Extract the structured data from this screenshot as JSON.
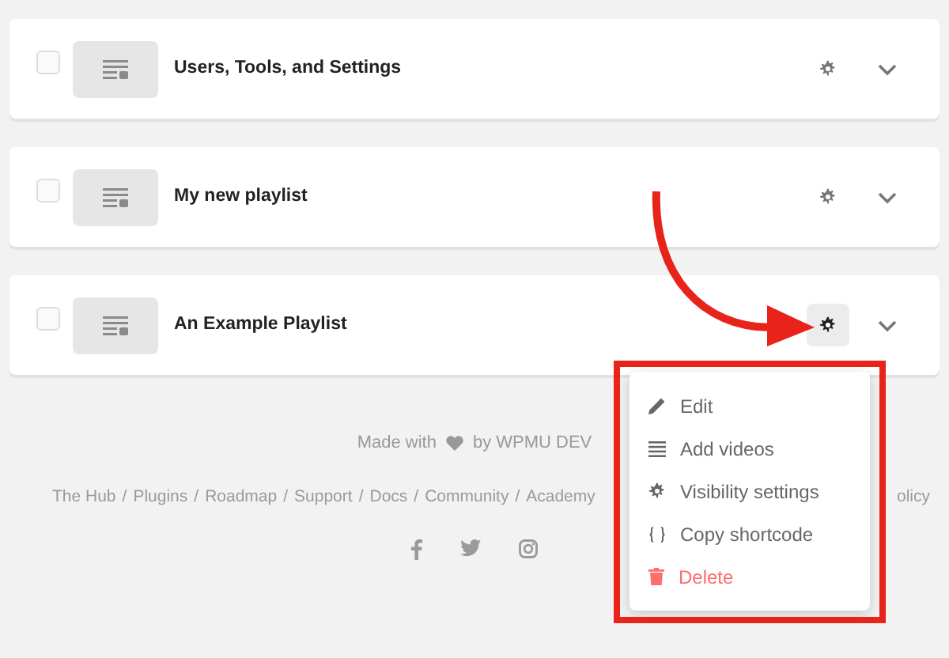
{
  "playlists": [
    {
      "title": "Users, Tools, and Settings",
      "checked": false,
      "menu_open": false
    },
    {
      "title": "My new playlist",
      "checked": false,
      "menu_open": false
    },
    {
      "title": "An Example Playlist",
      "checked": false,
      "menu_open": true
    }
  ],
  "menu": {
    "items": [
      {
        "kind": "edit",
        "label": "Edit"
      },
      {
        "kind": "list",
        "label": "Add videos"
      },
      {
        "kind": "gear",
        "label": "Visibility settings"
      },
      {
        "kind": "code",
        "label": "Copy shortcode"
      },
      {
        "kind": "delete",
        "label": "Delete"
      }
    ]
  },
  "footer": {
    "made_with": "Made with",
    "by": "by WPMU DEV",
    "separator": "/",
    "links": [
      "The Hub",
      "Plugins",
      "Roadmap",
      "Support",
      "Docs",
      "Community",
      "Academy"
    ],
    "links_tail": "olicy"
  }
}
